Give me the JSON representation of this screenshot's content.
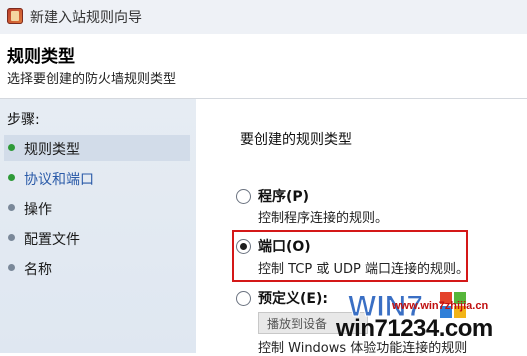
{
  "window": {
    "title": "新建入站规则向导"
  },
  "header": {
    "title": "规则类型",
    "subtitle": "选择要创建的防火墙规则类型"
  },
  "steps": {
    "heading": "步骤:",
    "items": [
      {
        "label": "规则类型",
        "state": "current"
      },
      {
        "label": "协议和端口",
        "state": "link"
      },
      {
        "label": "操作",
        "state": "normal"
      },
      {
        "label": "配置文件",
        "state": "normal"
      },
      {
        "label": "名称",
        "state": "normal"
      }
    ]
  },
  "panel": {
    "question": "要创建的规则类型",
    "options": [
      {
        "label": "程序(P)",
        "description": "控制程序连接的规则。",
        "selected": false
      },
      {
        "label": "端口(O)",
        "description": "控制 TCP 或 UDP 端口连接的规则。",
        "selected": true
      },
      {
        "label": "预定义(E):",
        "description": "控制 Windows 体验功能连接的规则",
        "selected": false
      }
    ],
    "predefined_dropdown_text": "播放到设备"
  },
  "watermark": {
    "logo": "WIN7",
    "text": "win71234.com",
    "site": "www.win7zhijia.cn"
  },
  "colors": {
    "highlight": "#d41818",
    "steps_bg": "#e2e9f2",
    "link": "#2a5aa8"
  }
}
